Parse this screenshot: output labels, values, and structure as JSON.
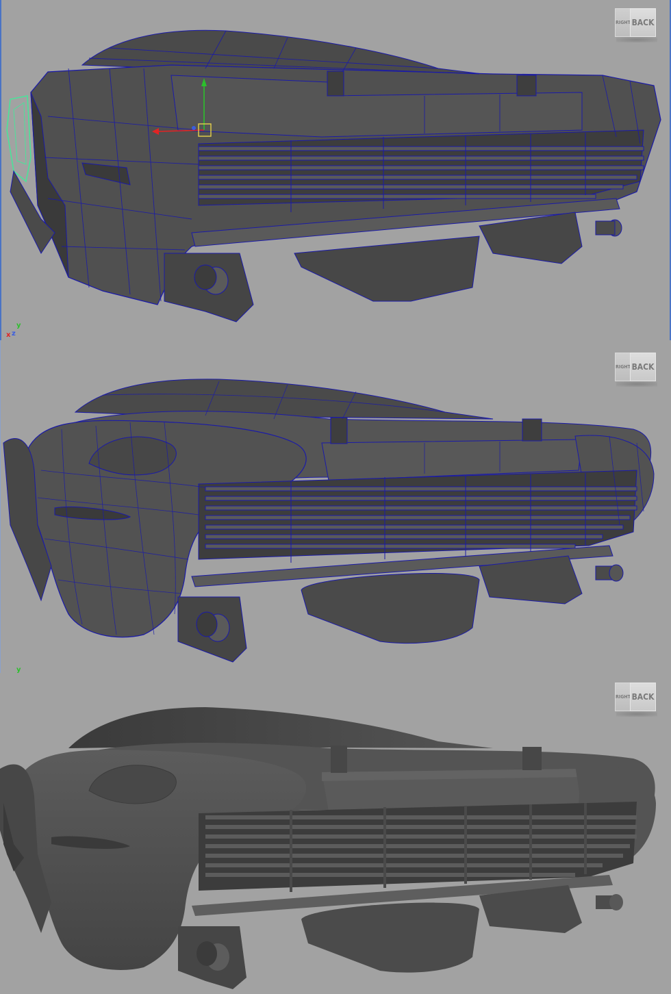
{
  "viewports": [
    {
      "id": "wireframe-on-shaded-low",
      "viewcube": {
        "left_face": "RIGHT",
        "front_face": "BACK"
      },
      "axis_labels": {
        "x": "x",
        "y": "y",
        "z": "z"
      }
    },
    {
      "id": "wireframe-on-shaded-smooth",
      "viewcube": {
        "left_face": "RIGHT",
        "front_face": "BACK"
      },
      "axis_labels": {
        "y": "y"
      }
    },
    {
      "id": "shaded-smooth",
      "viewcube": {
        "left_face": "RIGHT",
        "front_face": "BACK"
      }
    }
  ],
  "colors": {
    "viewport_bg": "#a2a2a2",
    "mesh_fill": "#4f4f4f",
    "mesh_dark": "#3b3b3b",
    "wire": "#1a1aa8",
    "selection_highlight": "#4be39a",
    "manipulator_x": "#e12424",
    "manipulator_y": "#2cc02c",
    "manipulator_center": "#e6d24a",
    "border_active": "#4a73c4"
  },
  "icons": [
    "viewcube-icon",
    "axis-gizmo-icon",
    "move-manipulator-icon"
  ]
}
